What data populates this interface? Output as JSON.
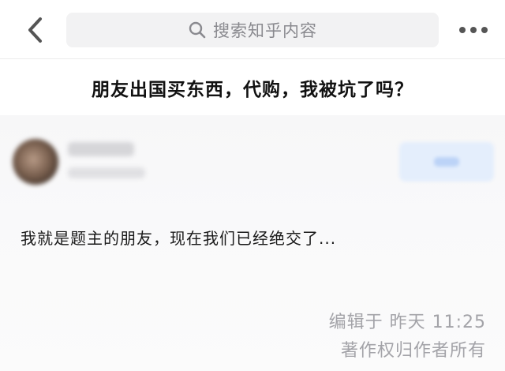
{
  "header": {
    "search_placeholder": "搜索知乎内容",
    "icons": {
      "back": "chevron-left-icon",
      "search": "search-icon",
      "more": "more-dots-icon"
    }
  },
  "question": {
    "title": "朋友出国买东西，代购，我被坑了吗？"
  },
  "answer": {
    "excerpt": "我就是题主的朋友，现在我们已经绝交了...",
    "edited": "编辑于 昨天 11:25",
    "copyright": "著作权归作者所有"
  },
  "colors": {
    "accent": "#0066ff",
    "muted_text": "#a3a3a8",
    "search_bg": "#f2f2f3"
  }
}
